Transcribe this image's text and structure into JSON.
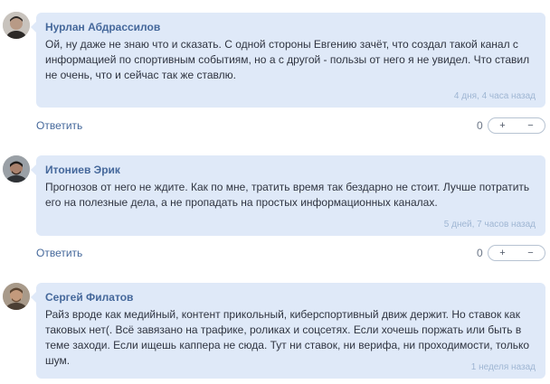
{
  "comments": [
    {
      "author": "Нурлан Абдрассилов",
      "text": "Ой, ну даже не знаю что и сказать. С одной стороны Евгению зачёт, что создал такой канал с информацией по спортивным событиям, но а с другой - пользы от него я не увидел. Что ставил не очень, что и сейчас так же ставлю.",
      "time": "4 дня, 4 часа назад",
      "reply": "Ответить",
      "score": "0",
      "plus": "+",
      "minus": "−"
    },
    {
      "author": "Итониев Эрик",
      "text": "Прогнозов от него не ждите. Как по мне, тратить время так бездарно не стоит. Лучше потратить его на полезные дела, а не пропадать на простых информационных каналах.",
      "time": "5 дней, 7 часов назад",
      "reply": "Ответить",
      "score": "0",
      "plus": "+",
      "minus": "−"
    },
    {
      "author": "Сергей Филатов",
      "text": "Райз вроде как медийный, контент прикольный, киберспортивный движ держит. Но ставок как таковых нет(. Всё завязано на трафике, роликах и соцсетях. Если хочешь поржать или быть в теме заходи. Если ищешь каппера не сюда. Тут ни ставок, ни верифа, ни проходимости, только шум.",
      "time": "1 неделя назад"
    }
  ]
}
